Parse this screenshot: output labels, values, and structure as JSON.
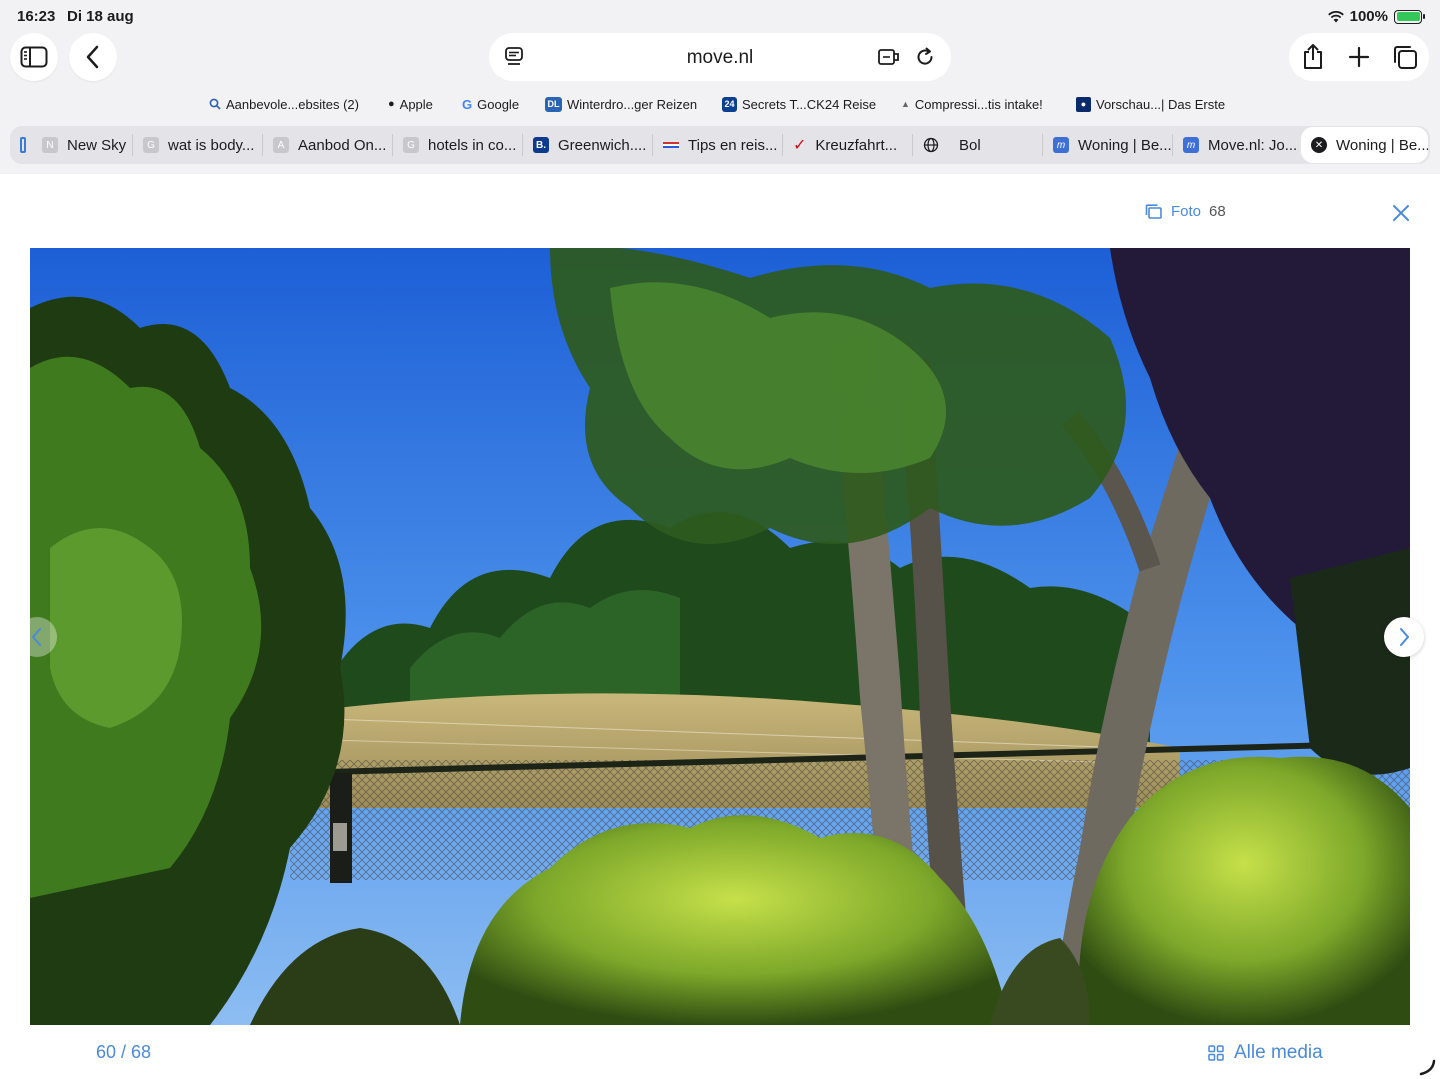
{
  "status": {
    "time": "16:23",
    "date": "Di 18 aug",
    "battery": "100%"
  },
  "address": {
    "url": "move.nl"
  },
  "bookmarks": [
    {
      "label": "Aanbevole...ebsites (2)",
      "icon": "search-icon"
    },
    {
      "label": "Apple",
      "icon": "apple-icon"
    },
    {
      "label": "Google",
      "icon": "google-icon"
    },
    {
      "label": "Winterdro...ger Reizen",
      "icon": "dl-icon"
    },
    {
      "label": "Secrets T...CK24 Reise",
      "icon": "check24-icon"
    },
    {
      "label": "Compressi...tis intake!",
      "icon": "site-icon"
    },
    {
      "label": "Vorschau...| Das Erste",
      "icon": "das-erste-icon"
    }
  ],
  "tabs": [
    {
      "label": "",
      "icon": "tab-group-icon"
    },
    {
      "label": "New Sky",
      "icon": "N"
    },
    {
      "label": "wat is body...",
      "icon": "G"
    },
    {
      "label": "Aanbod On...",
      "icon": "A"
    },
    {
      "label": "hotels in co...",
      "icon": "G"
    },
    {
      "label": "Greenwich....",
      "icon": "B."
    },
    {
      "label": "Tips en reis...",
      "icon": "flag-icon"
    },
    {
      "label": "Kreuzfahrt...",
      "icon": "tui-icon"
    },
    {
      "label": "Bol",
      "icon": "globe-icon"
    },
    {
      "label": "Woning | Be...",
      "icon": "m"
    },
    {
      "label": "Move.nl: Jo...",
      "icon": "m"
    },
    {
      "label": "Woning | Be...",
      "icon": "close-icon"
    }
  ],
  "viewer": {
    "photo_label": "Foto",
    "photo_total": "68",
    "pager": "60 / 68",
    "all_media": "Alle media"
  },
  "colors": {
    "accent": "#4a8ad9",
    "chrome_bg": "#f2f2f4",
    "tab_strip": "#e4e4e8"
  }
}
